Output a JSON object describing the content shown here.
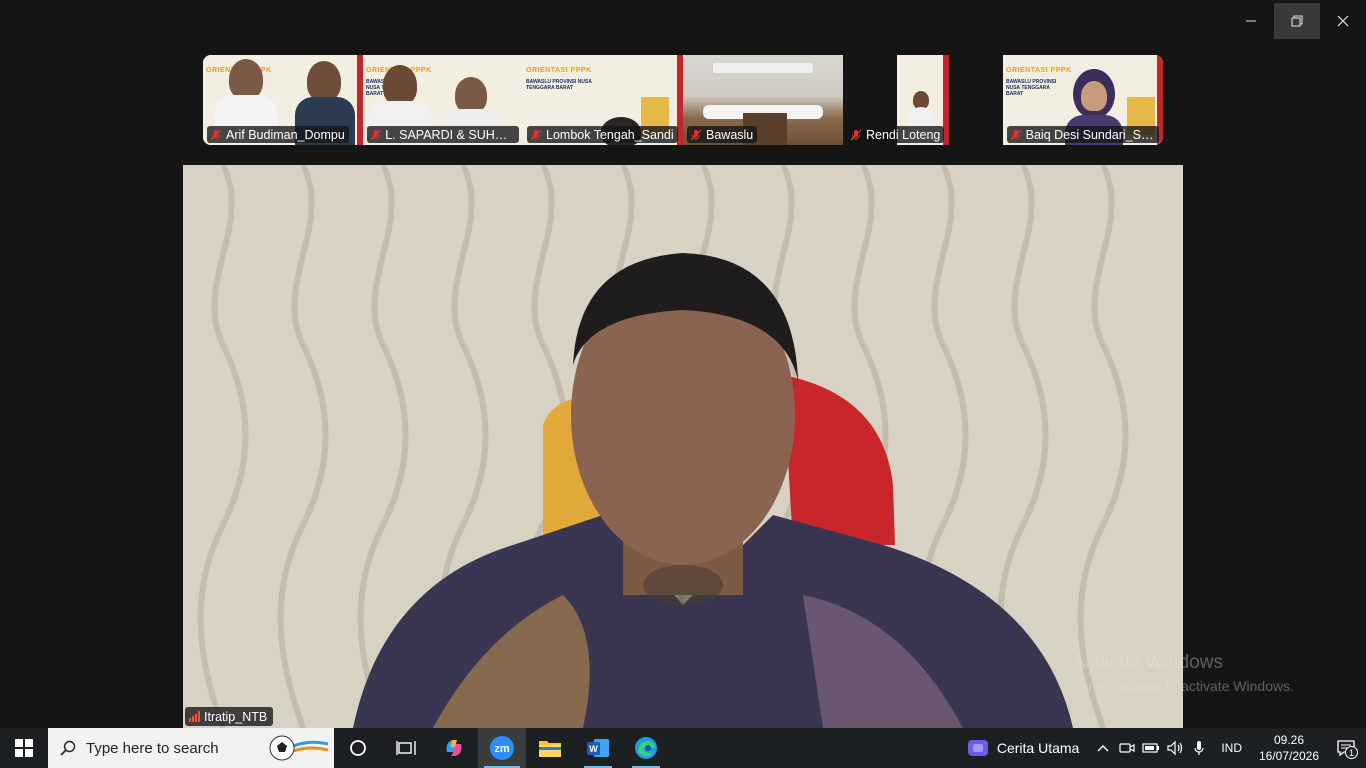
{
  "window": {
    "controls": {
      "minimize": "minimize",
      "restore": "restore",
      "close": "close"
    }
  },
  "participants": [
    {
      "name": "Arif Budiman_Dompu",
      "muted": true
    },
    {
      "name": "L. SAPARDI & SUHAR...",
      "muted": true
    },
    {
      "name": "Lombok Tengah_Sandi",
      "muted": true
    },
    {
      "name": "Bawaslu",
      "muted": true
    },
    {
      "name": "Rendi Loteng",
      "muted": true
    },
    {
      "name": "Baiq Desi Sundari_Se...",
      "muted": true
    }
  ],
  "posters": {
    "title": "ORIENTASI PPPK",
    "subtitle": "BAWASLU PROVINSI NUSA TENGGARA BARAT"
  },
  "active_speaker": {
    "name": "Itratip_NTB"
  },
  "watermark": {
    "line1": "Activate Windows",
    "line2": "Go to Settings to activate Windows."
  },
  "taskbar": {
    "search_placeholder": "Type here to search",
    "news_label": "Cerita Utama",
    "language": "IND",
    "time": "09.26",
    "date": "16/07/2026",
    "notification_count": "1",
    "apps": [
      "cortana-icon",
      "task-view-icon",
      "copilot-icon",
      "zoom-icon",
      "file-explorer-icon",
      "word-icon",
      "edge-icon"
    ]
  },
  "colors": {
    "accent": "#76b9ed",
    "muted_red": "#e0342a",
    "signal_red": "#ff4a3d"
  }
}
